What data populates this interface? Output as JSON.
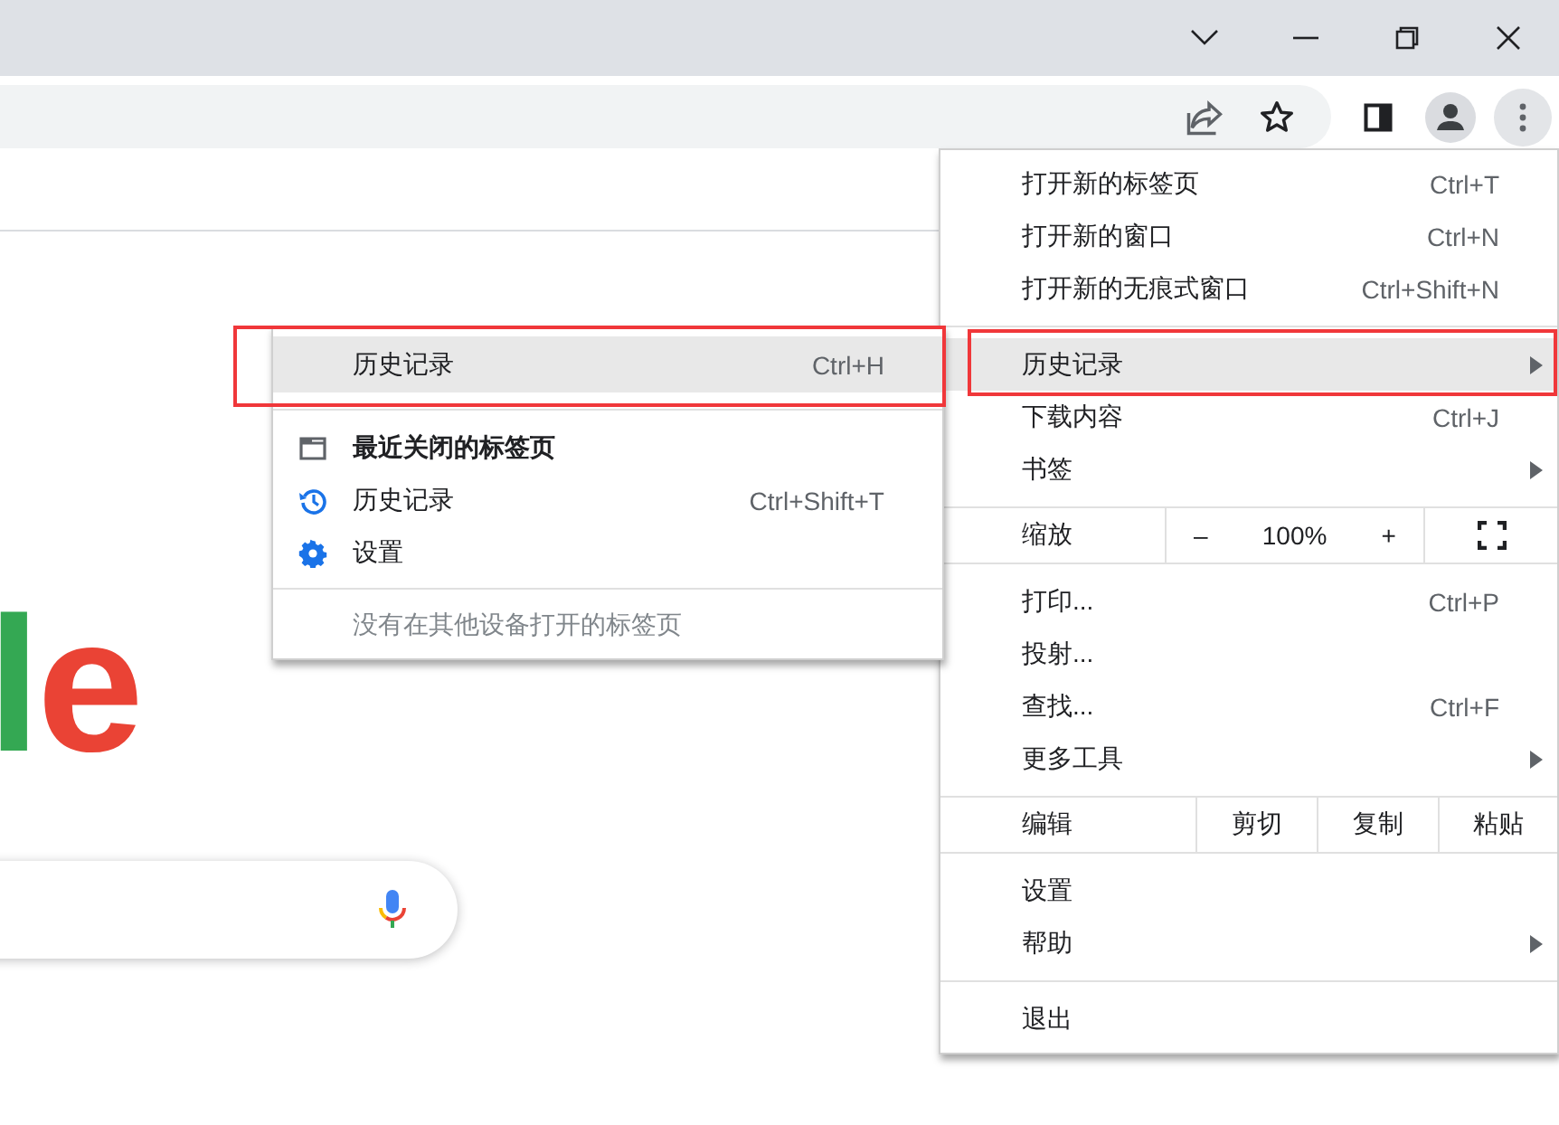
{
  "logo_letters": [
    {
      "char": "l",
      "color": "#34a853"
    },
    {
      "char": "e",
      "color": "#ea4335"
    }
  ],
  "menu": {
    "items": [
      {
        "kind": "item",
        "label": "打开新的标签页",
        "shortcut": "Ctrl+T",
        "submenu": false,
        "highlighted": false,
        "outlined": false
      },
      {
        "kind": "item",
        "label": "打开新的窗口",
        "shortcut": "Ctrl+N",
        "submenu": false,
        "highlighted": false,
        "outlined": false
      },
      {
        "kind": "item",
        "label": "打开新的无痕式窗口",
        "shortcut": "Ctrl+Shift+N",
        "submenu": false,
        "highlighted": false,
        "outlined": false
      },
      {
        "kind": "separator"
      },
      {
        "kind": "item",
        "label": "历史记录",
        "submenu": true,
        "highlighted": true,
        "outlined": true
      },
      {
        "kind": "item",
        "label": "下载内容",
        "shortcut": "Ctrl+J",
        "submenu": false,
        "highlighted": false,
        "outlined": false
      },
      {
        "kind": "item",
        "label": "书签",
        "submenu": true,
        "highlighted": false,
        "outlined": false
      },
      {
        "kind": "separator"
      },
      {
        "kind": "zoom",
        "label": "缩放",
        "minus": "–",
        "value": "100%",
        "plus": "+"
      },
      {
        "kind": "separator"
      },
      {
        "kind": "item",
        "label": "打印...",
        "shortcut": "Ctrl+P",
        "submenu": false,
        "highlighted": false,
        "outlined": false
      },
      {
        "kind": "item",
        "label": "投射...",
        "submenu": false,
        "highlighted": false,
        "outlined": false
      },
      {
        "kind": "item",
        "label": "查找...",
        "shortcut": "Ctrl+F",
        "submenu": false,
        "highlighted": false,
        "outlined": false
      },
      {
        "kind": "item",
        "label": "更多工具",
        "submenu": true,
        "highlighted": false,
        "outlined": false
      },
      {
        "kind": "separator"
      },
      {
        "kind": "edit",
        "label": "编辑",
        "buttons": [
          "剪切",
          "复制",
          "粘贴"
        ]
      },
      {
        "kind": "separator"
      },
      {
        "kind": "item",
        "label": "设置",
        "submenu": false,
        "highlighted": false,
        "outlined": false
      },
      {
        "kind": "item",
        "label": "帮助",
        "submenu": true,
        "highlighted": false,
        "outlined": false
      },
      {
        "kind": "separator"
      },
      {
        "kind": "item",
        "label": "退出",
        "submenu": false,
        "highlighted": false,
        "outlined": false
      }
    ]
  },
  "history_submenu": {
    "top_item": {
      "label": "历史记录",
      "shortcut": "Ctrl+H",
      "highlighted": true,
      "outlined": true
    },
    "recently_closed": {
      "label": "最近关闭的标签页"
    },
    "history_item": {
      "label": "历史记录",
      "shortcut": "Ctrl+Shift+T"
    },
    "settings_item": {
      "label": "设置"
    },
    "empty_note": "没有在其他设备打开的标签页"
  }
}
